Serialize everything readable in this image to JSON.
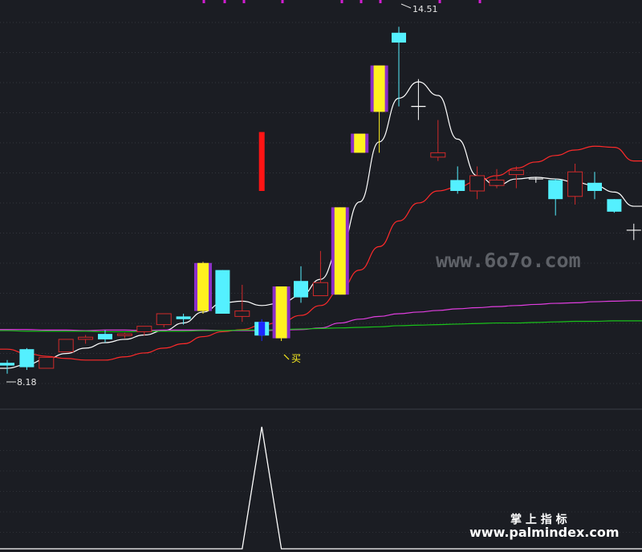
{
  "chart_data": [
    {
      "type": "candlestick",
      "panel": "main",
      "price_range": [
        7.5,
        15.0
      ],
      "high_label": "14.51",
      "low_label": "8.18",
      "buy_label": "买",
      "candles": [
        {
          "o": 8.3,
          "h": 8.4,
          "l": 8.15,
          "c": 8.35,
          "color": "cyan"
        },
        {
          "o": 8.27,
          "h": 8.62,
          "l": 8.22,
          "c": 8.6,
          "color": "cyan"
        },
        {
          "o": 8.25,
          "h": 8.45,
          "l": 8.25,
          "c": 8.45,
          "color": "red"
        },
        {
          "o": 8.55,
          "h": 8.78,
          "l": 8.55,
          "c": 8.78,
          "color": "red"
        },
        {
          "o": 8.78,
          "h": 8.86,
          "l": 8.7,
          "c": 8.82,
          "color": "red"
        },
        {
          "o": 8.88,
          "h": 8.95,
          "l": 8.72,
          "c": 8.78,
          "color": "cyan"
        },
        {
          "o": 8.85,
          "h": 8.9,
          "l": 8.8,
          "c": 8.88,
          "color": "red"
        },
        {
          "o": 8.92,
          "h": 9.02,
          "l": 8.85,
          "c": 9.02,
          "color": "red"
        },
        {
          "o": 9.05,
          "h": 9.25,
          "l": 9.0,
          "c": 9.25,
          "color": "red"
        },
        {
          "o": 9.15,
          "h": 9.25,
          "l": 9.05,
          "c": 9.2,
          "color": "cyan"
        },
        {
          "o": 9.3,
          "h": 10.2,
          "l": 9.25,
          "c": 10.18,
          "color": "yellow"
        },
        {
          "o": 10.05,
          "h": 10.05,
          "l": 9.25,
          "c": 9.25,
          "color": "cyan"
        },
        {
          "o": 9.2,
          "h": 9.78,
          "l": 9.1,
          "c": 9.3,
          "color": "red"
        },
        {
          "o": 9.1,
          "h": 9.15,
          "l": 8.75,
          "c": 8.85,
          "color": "blue"
        },
        {
          "o": 8.8,
          "h": 9.75,
          "l": 8.75,
          "c": 9.75,
          "color": "yellow"
        },
        {
          "o": 9.85,
          "h": 10.12,
          "l": 9.45,
          "c": 9.55,
          "color": "cyan"
        },
        {
          "o": 9.58,
          "h": 10.4,
          "l": 9.58,
          "c": 9.82,
          "color": "red"
        },
        {
          "o": 9.6,
          "h": 11.2,
          "l": 9.6,
          "c": 11.2,
          "color": "yellow"
        },
        {
          "o": 12.2,
          "h": 12.2,
          "l": 12.2,
          "c": 12.55,
          "color": "yellow"
        },
        {
          "o": 12.95,
          "h": 13.8,
          "l": 12.2,
          "c": 13.8,
          "color": "yellow"
        },
        {
          "o": 14.4,
          "h": 14.51,
          "l": 13.05,
          "c": 14.22,
          "color": "cyan"
        },
        {
          "o": 13.05,
          "h": 13.55,
          "l": 12.8,
          "c": 13.05,
          "color": "white"
        },
        {
          "o": 12.2,
          "h": 12.8,
          "l": 12.05,
          "c": 12.12,
          "color": "red"
        },
        {
          "o": 11.7,
          "h": 11.95,
          "l": 11.45,
          "c": 11.5,
          "color": "cyan"
        },
        {
          "o": 11.5,
          "h": 11.95,
          "l": 11.35,
          "c": 11.78,
          "color": "red"
        },
        {
          "o": 11.6,
          "h": 11.9,
          "l": 11.55,
          "c": 11.7,
          "color": "red"
        },
        {
          "o": 11.8,
          "h": 11.95,
          "l": 11.55,
          "c": 11.88,
          "color": "red"
        },
        {
          "o": 11.72,
          "h": 11.75,
          "l": 11.65,
          "c": 11.72,
          "color": "white"
        },
        {
          "o": 11.7,
          "h": 11.72,
          "l": 11.05,
          "c": 11.35,
          "color": "cyan"
        },
        {
          "o": 11.4,
          "h": 12.0,
          "l": 11.25,
          "c": 11.85,
          "color": "red"
        },
        {
          "o": 11.65,
          "h": 11.85,
          "l": 11.35,
          "c": 11.5,
          "color": "cyan"
        },
        {
          "o": 11.35,
          "h": 11.35,
          "l": 11.1,
          "c": 11.12,
          "color": "cyan"
        },
        {
          "o": 10.78,
          "h": 10.9,
          "l": 10.6,
          "c": 10.78,
          "color": "white"
        }
      ],
      "red_signal": {
        "index": 13,
        "top": 12.58,
        "bottom": 11.5
      },
      "series": [
        {
          "color": "#ffffff",
          "values": [
            8.25,
            8.32,
            8.42,
            8.52,
            8.62,
            8.72,
            8.78,
            8.86,
            8.94,
            9.08,
            9.28,
            9.45,
            9.48,
            9.4,
            9.45,
            9.58,
            9.88,
            10.45,
            11.3,
            12.4,
            13.2,
            13.5,
            13.25,
            12.45,
            11.78,
            11.6,
            11.72,
            11.75,
            11.72,
            11.66,
            11.6,
            11.48,
            11.22
          ]
        },
        {
          "color": "#ff2a2a",
          "values": [
            8.6,
            8.52,
            8.47,
            8.43,
            8.4,
            8.4,
            8.46,
            8.53,
            8.62,
            8.7,
            8.83,
            8.92,
            8.96,
            9.04,
            9.1,
            9.22,
            9.4,
            9.68,
            10.05,
            10.48,
            10.95,
            11.28,
            11.5,
            11.57,
            11.68,
            11.78,
            11.92,
            12.03,
            12.15,
            12.25,
            12.32,
            12.3,
            12.05
          ]
        },
        {
          "color": "#e13ee0",
          "values": [
            8.96,
            8.96,
            8.95,
            8.95,
            8.94,
            8.95,
            8.95,
            8.94,
            8.95,
            8.95,
            8.95,
            8.94,
            8.94,
            8.94,
            8.95,
            8.96,
            8.99,
            9.08,
            9.15,
            9.2,
            9.25,
            9.28,
            9.31,
            9.34,
            9.36,
            9.38,
            9.4,
            9.42,
            9.44,
            9.45,
            9.47,
            9.48,
            9.49
          ]
        },
        {
          "color": "#19c21a",
          "values": [
            8.94,
            8.93,
            8.93,
            8.93,
            8.93,
            8.92,
            8.92,
            8.93,
            8.93,
            8.93,
            8.94,
            8.94,
            8.95,
            8.95,
            8.96,
            8.97,
            8.98,
            8.99,
            9.0,
            9.01,
            9.03,
            9.04,
            9.05,
            9.06,
            9.07,
            9.08,
            9.08,
            9.09,
            9.1,
            9.11,
            9.11,
            9.12,
            9.12
          ]
        }
      ]
    },
    {
      "type": "line",
      "panel": "indicator",
      "ylim": [
        0,
        1
      ],
      "x": [
        0,
        12,
        13,
        14,
        32
      ],
      "values": [
        0,
        0,
        1,
        0,
        0
      ],
      "color": "#ffffff"
    }
  ],
  "watermarks": {
    "site_6070": "www.6o7o.com",
    "brand_cn": "掌 上 指 标",
    "brand_url": "www.palmindex.com"
  },
  "colors": {
    "background": "#1b1d23",
    "cyan": "#54f0ff",
    "yellow": "#fff21f",
    "purple_edge": "#8b2fc9",
    "red": "#d12a2a",
    "blue": "#1e28ff",
    "magenta_dot": "#d21ed2"
  }
}
